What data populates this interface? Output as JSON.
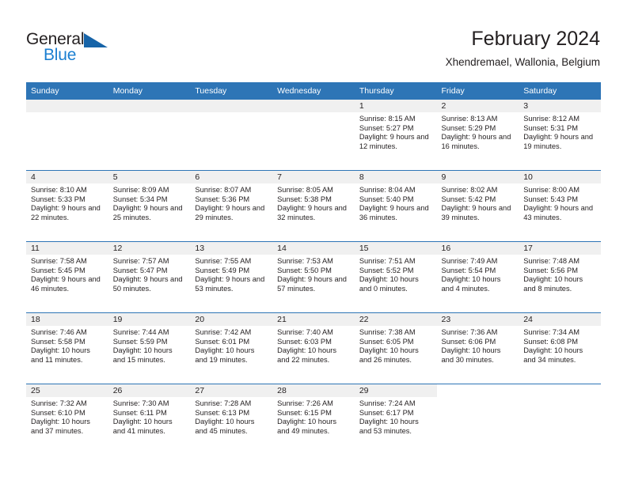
{
  "brand": {
    "name_top": "General",
    "name_bottom": "Blue",
    "triangle_color": "#1764a8",
    "blue_color": "#1b7fd1"
  },
  "header": {
    "title": "February 2024",
    "location": "Xhendremael, Wallonia, Belgium"
  },
  "theme": {
    "header_blue": "#2e75b6",
    "row_border_blue": "#2e75b6",
    "daynum_band": "#f0f0f0",
    "text": "#231f20"
  },
  "weekday_headers": [
    "Sunday",
    "Monday",
    "Tuesday",
    "Wednesday",
    "Thursday",
    "Friday",
    "Saturday"
  ],
  "labels": {
    "sunrise": "Sunrise:",
    "sunset": "Sunset:",
    "daylight": "Daylight:"
  },
  "weeks": [
    [
      {
        "day": "",
        "sunrise": "",
        "sunset": "",
        "daylight": "",
        "blank": true
      },
      {
        "day": "",
        "sunrise": "",
        "sunset": "",
        "daylight": "",
        "blank": true
      },
      {
        "day": "",
        "sunrise": "",
        "sunset": "",
        "daylight": "",
        "blank": true
      },
      {
        "day": "",
        "sunrise": "",
        "sunset": "",
        "daylight": "",
        "blank": true
      },
      {
        "day": "1",
        "sunrise": "Sunrise: 8:15 AM",
        "sunset": "Sunset: 5:27 PM",
        "daylight": "Daylight: 9 hours and 12 minutes."
      },
      {
        "day": "2",
        "sunrise": "Sunrise: 8:13 AM",
        "sunset": "Sunset: 5:29 PM",
        "daylight": "Daylight: 9 hours and 16 minutes."
      },
      {
        "day": "3",
        "sunrise": "Sunrise: 8:12 AM",
        "sunset": "Sunset: 5:31 PM",
        "daylight": "Daylight: 9 hours and 19 minutes."
      }
    ],
    [
      {
        "day": "4",
        "sunrise": "Sunrise: 8:10 AM",
        "sunset": "Sunset: 5:33 PM",
        "daylight": "Daylight: 9 hours and 22 minutes."
      },
      {
        "day": "5",
        "sunrise": "Sunrise: 8:09 AM",
        "sunset": "Sunset: 5:34 PM",
        "daylight": "Daylight: 9 hours and 25 minutes."
      },
      {
        "day": "6",
        "sunrise": "Sunrise: 8:07 AM",
        "sunset": "Sunset: 5:36 PM",
        "daylight": "Daylight: 9 hours and 29 minutes."
      },
      {
        "day": "7",
        "sunrise": "Sunrise: 8:05 AM",
        "sunset": "Sunset: 5:38 PM",
        "daylight": "Daylight: 9 hours and 32 minutes."
      },
      {
        "day": "8",
        "sunrise": "Sunrise: 8:04 AM",
        "sunset": "Sunset: 5:40 PM",
        "daylight": "Daylight: 9 hours and 36 minutes."
      },
      {
        "day": "9",
        "sunrise": "Sunrise: 8:02 AM",
        "sunset": "Sunset: 5:42 PM",
        "daylight": "Daylight: 9 hours and 39 minutes."
      },
      {
        "day": "10",
        "sunrise": "Sunrise: 8:00 AM",
        "sunset": "Sunset: 5:43 PM",
        "daylight": "Daylight: 9 hours and 43 minutes."
      }
    ],
    [
      {
        "day": "11",
        "sunrise": "Sunrise: 7:58 AM",
        "sunset": "Sunset: 5:45 PM",
        "daylight": "Daylight: 9 hours and 46 minutes."
      },
      {
        "day": "12",
        "sunrise": "Sunrise: 7:57 AM",
        "sunset": "Sunset: 5:47 PM",
        "daylight": "Daylight: 9 hours and 50 minutes."
      },
      {
        "day": "13",
        "sunrise": "Sunrise: 7:55 AM",
        "sunset": "Sunset: 5:49 PM",
        "daylight": "Daylight: 9 hours and 53 minutes."
      },
      {
        "day": "14",
        "sunrise": "Sunrise: 7:53 AM",
        "sunset": "Sunset: 5:50 PM",
        "daylight": "Daylight: 9 hours and 57 minutes."
      },
      {
        "day": "15",
        "sunrise": "Sunrise: 7:51 AM",
        "sunset": "Sunset: 5:52 PM",
        "daylight": "Daylight: 10 hours and 0 minutes."
      },
      {
        "day": "16",
        "sunrise": "Sunrise: 7:49 AM",
        "sunset": "Sunset: 5:54 PM",
        "daylight": "Daylight: 10 hours and 4 minutes."
      },
      {
        "day": "17",
        "sunrise": "Sunrise: 7:48 AM",
        "sunset": "Sunset: 5:56 PM",
        "daylight": "Daylight: 10 hours and 8 minutes."
      }
    ],
    [
      {
        "day": "18",
        "sunrise": "Sunrise: 7:46 AM",
        "sunset": "Sunset: 5:58 PM",
        "daylight": "Daylight: 10 hours and 11 minutes."
      },
      {
        "day": "19",
        "sunrise": "Sunrise: 7:44 AM",
        "sunset": "Sunset: 5:59 PM",
        "daylight": "Daylight: 10 hours and 15 minutes."
      },
      {
        "day": "20",
        "sunrise": "Sunrise: 7:42 AM",
        "sunset": "Sunset: 6:01 PM",
        "daylight": "Daylight: 10 hours and 19 minutes."
      },
      {
        "day": "21",
        "sunrise": "Sunrise: 7:40 AM",
        "sunset": "Sunset: 6:03 PM",
        "daylight": "Daylight: 10 hours and 22 minutes."
      },
      {
        "day": "22",
        "sunrise": "Sunrise: 7:38 AM",
        "sunset": "Sunset: 6:05 PM",
        "daylight": "Daylight: 10 hours and 26 minutes."
      },
      {
        "day": "23",
        "sunrise": "Sunrise: 7:36 AM",
        "sunset": "Sunset: 6:06 PM",
        "daylight": "Daylight: 10 hours and 30 minutes."
      },
      {
        "day": "24",
        "sunrise": "Sunrise: 7:34 AM",
        "sunset": "Sunset: 6:08 PM",
        "daylight": "Daylight: 10 hours and 34 minutes."
      }
    ],
    [
      {
        "day": "25",
        "sunrise": "Sunrise: 7:32 AM",
        "sunset": "Sunset: 6:10 PM",
        "daylight": "Daylight: 10 hours and 37 minutes."
      },
      {
        "day": "26",
        "sunrise": "Sunrise: 7:30 AM",
        "sunset": "Sunset: 6:11 PM",
        "daylight": "Daylight: 10 hours and 41 minutes."
      },
      {
        "day": "27",
        "sunrise": "Sunrise: 7:28 AM",
        "sunset": "Sunset: 6:13 PM",
        "daylight": "Daylight: 10 hours and 45 minutes."
      },
      {
        "day": "28",
        "sunrise": "Sunrise: 7:26 AM",
        "sunset": "Sunset: 6:15 PM",
        "daylight": "Daylight: 10 hours and 49 minutes."
      },
      {
        "day": "29",
        "sunrise": "Sunrise: 7:24 AM",
        "sunset": "Sunset: 6:17 PM",
        "daylight": "Daylight: 10 hours and 53 minutes."
      },
      {
        "day": "",
        "sunrise": "",
        "sunset": "",
        "daylight": "",
        "none": true
      },
      {
        "day": "",
        "sunrise": "",
        "sunset": "",
        "daylight": "",
        "none": true
      }
    ]
  ]
}
